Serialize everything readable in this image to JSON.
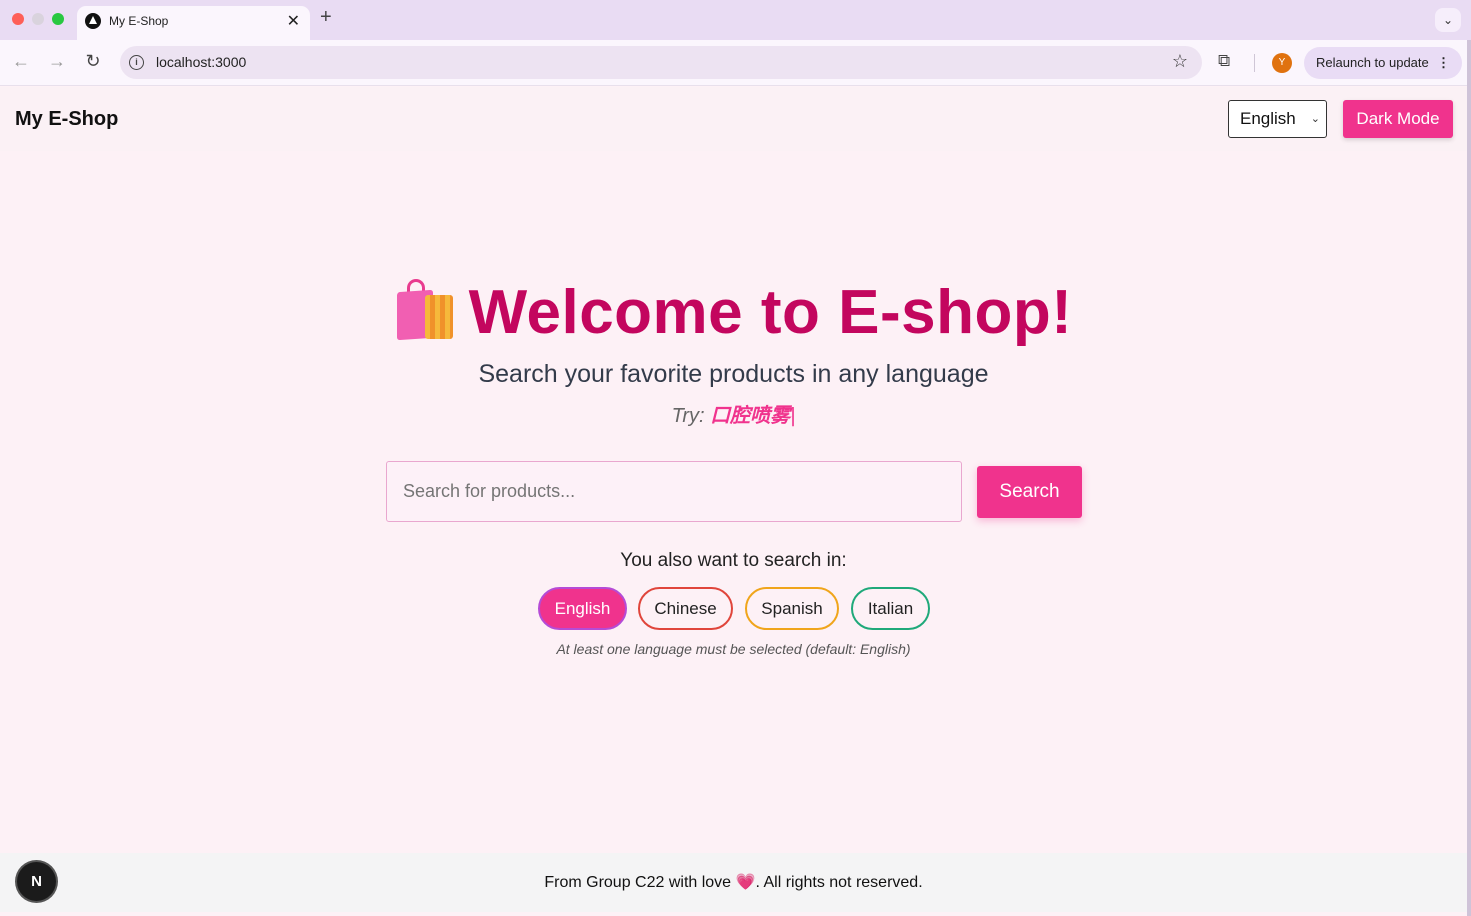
{
  "browser": {
    "tab_title": "My E-Shop",
    "tab_close": "✕",
    "new_tab": "+",
    "url": "localhost:3000",
    "relaunch_label": "Relaunch to update",
    "profile_initial": "Y"
  },
  "navbar": {
    "brand": "My E-Shop",
    "language_selected": "English",
    "dark_mode_label": "Dark Mode"
  },
  "hero": {
    "title": "Welcome to E-shop!",
    "subtitle": "Search your favorite products in any language",
    "try_prefix": "Try:",
    "try_example": "口腔喷雾"
  },
  "search": {
    "placeholder": "Search for products...",
    "button_label": "Search"
  },
  "languages": {
    "prompt": "You also want to search in:",
    "options": [
      {
        "label": "English",
        "selected": true
      },
      {
        "label": "Chinese",
        "selected": false
      },
      {
        "label": "Spanish",
        "selected": false
      },
      {
        "label": "Italian",
        "selected": false
      }
    ],
    "hint": "At least one language must be selected (default: English)"
  },
  "footer": {
    "text_before": "From Group C22 with love ",
    "heart": "💗",
    "text_after": ". All rights not reserved."
  },
  "dev_badge": "N",
  "colors": {
    "accent": "#f0338d",
    "title": "#c3065e",
    "background": "#fdf1f6"
  }
}
